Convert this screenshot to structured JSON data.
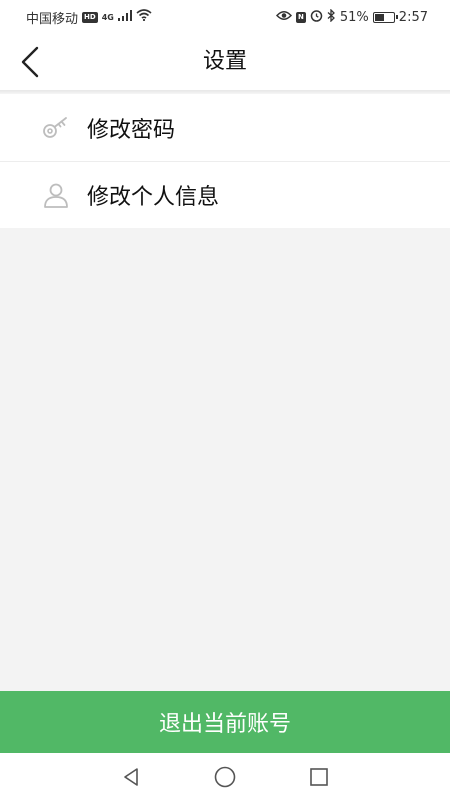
{
  "status_bar": {
    "carrier": "中国移动",
    "hd_badge": "HD",
    "network": "4G",
    "nfc_badge": "N",
    "battery_percent": "51%",
    "battery_level": 0.51,
    "time": "2:57"
  },
  "nav": {
    "title": "设置"
  },
  "menu": {
    "items": [
      {
        "label": "修改密码",
        "icon": "key-icon"
      },
      {
        "label": "修改个人信息",
        "icon": "user-icon"
      }
    ]
  },
  "logout": {
    "label": "退出当前账号"
  },
  "colors": {
    "accent": "#51b866",
    "background": "#f3f3f3"
  }
}
